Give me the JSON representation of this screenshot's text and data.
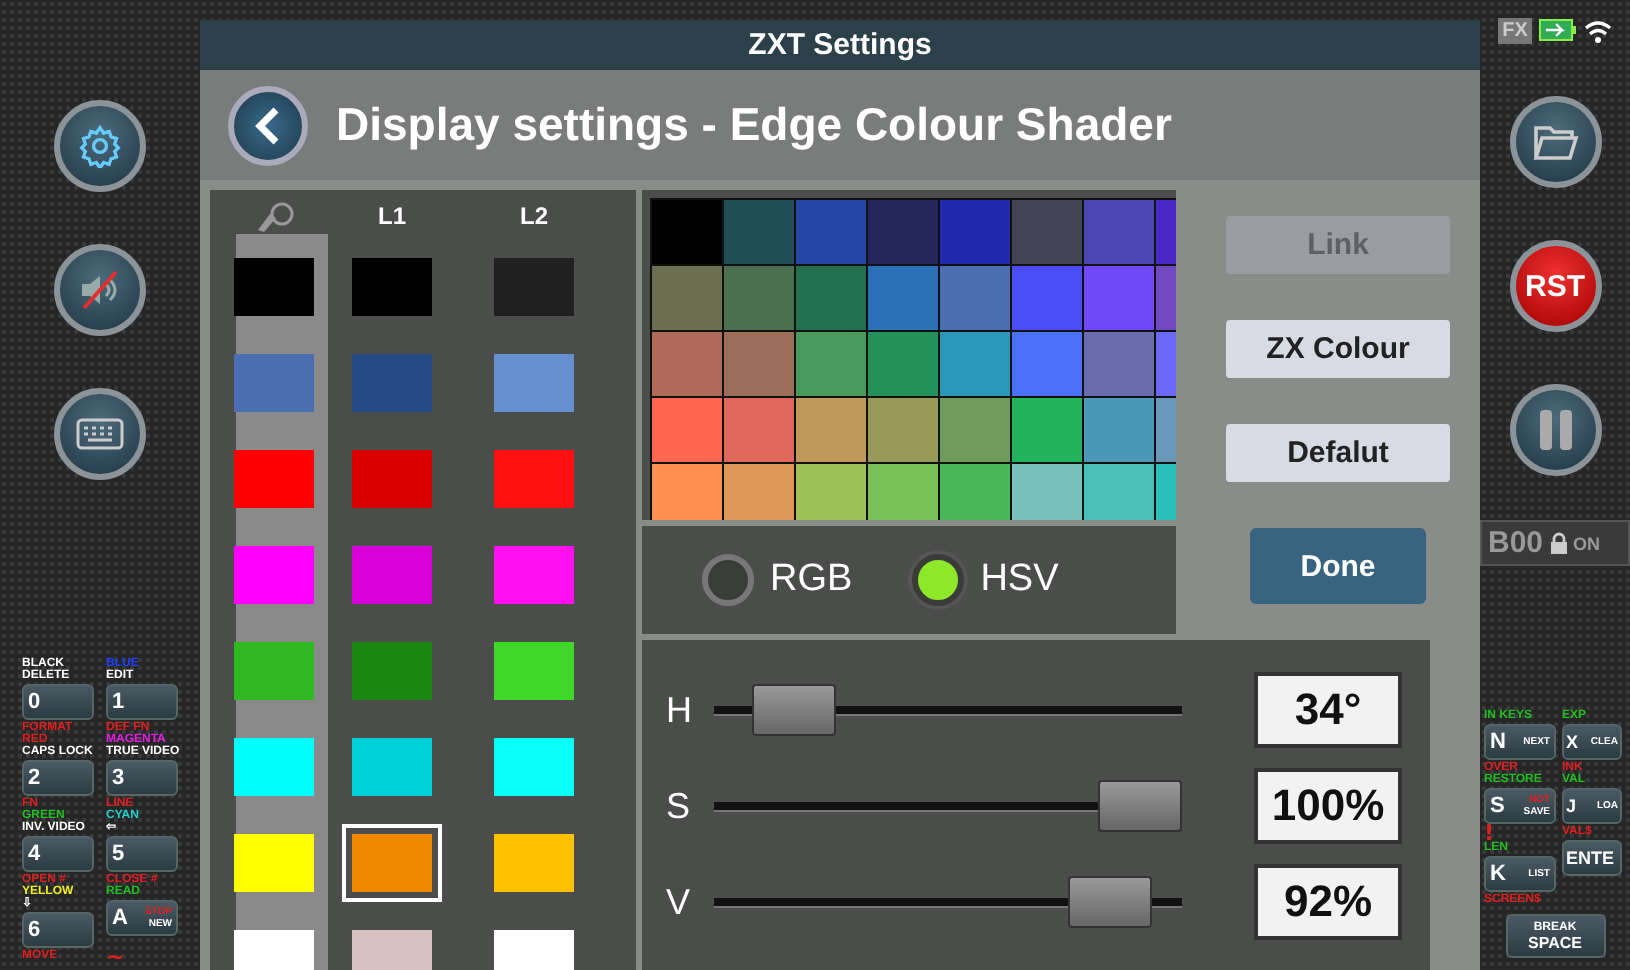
{
  "title_bar": {
    "title": "ZXT Settings"
  },
  "header": {
    "title": "Display settings - Edge Colour Shader"
  },
  "status_icons": {
    "fx_badge": "FX"
  },
  "left_buttons": [
    {
      "kind": "settings"
    },
    {
      "kind": "mute"
    },
    {
      "kind": "keyboard"
    }
  ],
  "right_buttons": [
    {
      "kind": "folder"
    },
    {
      "kind": "reset",
      "label": "RST"
    },
    {
      "kind": "pause"
    }
  ],
  "bank_status": {
    "bank": "B00",
    "state": "ON"
  },
  "colour_list": {
    "columns": [
      "L1",
      "L2"
    ],
    "rows": [
      {
        "swatches": [
          {
            "color": "#000000",
            "selected": false
          },
          {
            "color": "#000000",
            "selected": false
          },
          {
            "color": "#202020",
            "selected": false
          }
        ]
      },
      {
        "swatches": [
          {
            "color": "#4a6eb0",
            "selected": false
          },
          {
            "color": "#284a84",
            "selected": false
          },
          {
            "color": "#6490d0",
            "selected": false
          }
        ]
      },
      {
        "swatches": [
          {
            "color": "#ff0000",
            "selected": false
          },
          {
            "color": "#d80000",
            "selected": false
          },
          {
            "color": "#ff1010",
            "selected": false
          }
        ]
      },
      {
        "swatches": [
          {
            "color": "#ff00ff",
            "selected": false
          },
          {
            "color": "#d800d8",
            "selected": false
          },
          {
            "color": "#ff10f0",
            "selected": false
          }
        ]
      },
      {
        "swatches": [
          {
            "color": "#30b820",
            "selected": false
          },
          {
            "color": "#188810",
            "selected": false
          },
          {
            "color": "#40d828",
            "selected": false
          }
        ]
      },
      {
        "swatches": [
          {
            "color": "#00ffff",
            "selected": false
          },
          {
            "color": "#00d0d8",
            "selected": false
          },
          {
            "color": "#08fff8",
            "selected": false
          }
        ]
      },
      {
        "swatches": [
          {
            "color": "#ffff00",
            "selected": false
          },
          {
            "color": "#f08800",
            "selected": true
          },
          {
            "color": "#ffc000",
            "selected": false
          }
        ]
      },
      {
        "swatches": [
          {
            "color": "#ffffff",
            "selected": false
          },
          {
            "color": "#d8c0c0",
            "selected": false
          },
          {
            "color": "#ffffff",
            "selected": false
          }
        ]
      }
    ]
  },
  "palette": [
    {
      "cells": [
        {
          "color": "#000000"
        },
        {
          "color": "#1d4d55"
        },
        {
          "color": "#2446a8"
        },
        {
          "color": "#25265c"
        },
        {
          "color": "#2328b0"
        },
        {
          "color": "#424456"
        },
        {
          "color": "#4a48b0"
        },
        {
          "color": "#4a28c8"
        }
      ]
    },
    {
      "cells": [
        {
          "color": "#6b6e50"
        },
        {
          "color": "#4a7050"
        },
        {
          "color": "#22704e"
        },
        {
          "color": "#2a70b8"
        },
        {
          "color": "#4a6eb0"
        },
        {
          "color": "#4a4cf6"
        },
        {
          "color": "#7048f8"
        },
        {
          "color": "#7048c0"
        }
      ]
    },
    {
      "cells": [
        {
          "color": "#b06a5a"
        },
        {
          "color": "#9a6e58"
        },
        {
          "color": "#4a9a5c"
        },
        {
          "color": "#22925a"
        },
        {
          "color": "#2a98b8"
        },
        {
          "color": "#4a70f6"
        },
        {
          "color": "#6a6cb0"
        },
        {
          "color": "#6a68f8"
        }
      ]
    },
    {
      "cells": [
        {
          "color": "#ff6650"
        },
        {
          "color": "#e0685a"
        },
        {
          "color": "#c09858"
        },
        {
          "color": "#9a9a58"
        },
        {
          "color": "#6e9a5a"
        },
        {
          "color": "#22b25c"
        },
        {
          "color": "#4a98b8"
        },
        {
          "color": "#6a98b8"
        }
      ]
    },
    {
      "cells": [
        {
          "color": "#ff9050"
        },
        {
          "color": "#e09858"
        },
        {
          "color": "#a0c058"
        },
        {
          "color": "#78c058"
        },
        {
          "color": "#48b858"
        },
        {
          "color": "#78c0b8"
        },
        {
          "color": "#48c0b8"
        },
        {
          "color": "#28c0b8"
        }
      ]
    }
  ],
  "mode": [
    {
      "label": "RGB",
      "selected": false
    },
    {
      "label": "HSV",
      "selected": true
    }
  ],
  "actions": [
    {
      "label": "Link",
      "disabled": true
    },
    {
      "label": "ZX Colour",
      "disabled": false
    },
    {
      "label": "Defalut",
      "disabled": false
    }
  ],
  "done_button": "Done",
  "sliders": [
    {
      "name": "H",
      "level": 0.1,
      "reading": "34°"
    },
    {
      "name": "S",
      "level": 1.0,
      "reading": "100%"
    },
    {
      "name": "V",
      "level": 0.92,
      "reading": "92%"
    }
  ],
  "left_keys": [
    {
      "labels": [
        {
          "text": "BLACK",
          "color": "#ffffff"
        },
        {
          "text": "DELETE",
          "color": "#ffffff"
        }
      ],
      "key": "0"
    },
    {
      "labels": [
        {
          "text": "BLUE",
          "color": "#2040ff"
        },
        {
          "text": "EDIT",
          "color": "#ffffff"
        }
      ],
      "key": "1"
    },
    {
      "labels": [
        {
          "text": "FORMAT",
          "color": "#e02020"
        },
        {
          "text": "RED",
          "color": "#e02020"
        },
        {
          "text": "CAPS LOCK",
          "color": "#ffffff"
        }
      ],
      "key": "2"
    },
    {
      "labels": [
        {
          "text": "DEF FN",
          "color": "#e02020"
        },
        {
          "text": "MAGENTA",
          "color": "#e020e0"
        },
        {
          "text": "TRUE VIDEO",
          "color": "#ffffff"
        }
      ],
      "key": "3"
    },
    {
      "labels": [
        {
          "text": "FN",
          "color": "#e02020"
        },
        {
          "text": "GREEN",
          "color": "#20c020"
        },
        {
          "text": "INV. VIDEO",
          "color": "#ffffff"
        }
      ],
      "key": "4"
    },
    {
      "labels": [
        {
          "text": "LINE",
          "color": "#e02020"
        },
        {
          "text": "CYAN",
          "color": "#20d0d0"
        },
        {
          "text": "⇦",
          "color": "#ffffff"
        }
      ],
      "key": "5"
    },
    {
      "labels": [
        {
          "text": "OPEN #",
          "color": "#e02020"
        },
        {
          "text": "YELLOW",
          "color": "#f0f020"
        },
        {
          "text": "⇩",
          "color": "#ffffff"
        }
      ],
      "key": "6"
    },
    {
      "labels": [
        {
          "text": "CLOSE #",
          "color": "#e02020"
        },
        {
          "text": "READ",
          "color": "#20c020"
        }
      ],
      "key": "A",
      "inner": [
        {
          "text": "STOP",
          "color": "#e02020"
        },
        {
          "text": "NEW",
          "color": "#ffffff"
        }
      ]
    }
  ],
  "left_keys_footer": [
    {
      "text": "MOVE",
      "color": "#e02020"
    },
    {
      "text": "~",
      "color": "#e02020"
    }
  ],
  "right_keys": [
    {
      "labels": [
        {
          "text": "IN KEYS",
          "color": "#20c020"
        }
      ],
      "key": "N",
      "inner": [
        {
          "text": "NEXT",
          "color": "#ffffff"
        }
      ]
    },
    {
      "labels": [
        {
          "text": "EXP",
          "color": "#20c020"
        }
      ],
      "key": "X",
      "inner": [
        {
          "text": "CLEA",
          "color": "#ffffff"
        }
      ]
    },
    {
      "labels": [
        {
          "text": "OVER",
          "color": "#e02020"
        },
        {
          "text": "RESTORE",
          "color": "#20c020"
        }
      ],
      "key": "S",
      "inner": [
        {
          "text": "NOT",
          "color": "#e02020"
        },
        {
          "text": "SAVE",
          "color": "#ffffff"
        }
      ]
    },
    {
      "labels": [
        {
          "text": "INK",
          "color": "#e02020"
        },
        {
          "text": "VAL",
          "color": "#20c020"
        }
      ],
      "key": "J",
      "inner": [
        {
          "text": "LOA",
          "color": "#ffffff"
        }
      ]
    },
    {
      "labels": [
        {
          "text": "!",
          "color": "#e02020"
        },
        {
          "text": "LEN",
          "color": "#20c020"
        }
      ],
      "key": "K",
      "inner": [
        {
          "text": "LIST",
          "color": "#ffffff"
        }
      ]
    },
    {
      "labels": [
        {
          "text": "VAL$",
          "color": "#e02020"
        }
      ],
      "key": "ENTE"
    }
  ],
  "right_keys_footer": [
    {
      "text": "SCREEN$",
      "color": "#e02020"
    }
  ],
  "space_key": {
    "top": "BREAK",
    "bottom": "SPACE"
  }
}
